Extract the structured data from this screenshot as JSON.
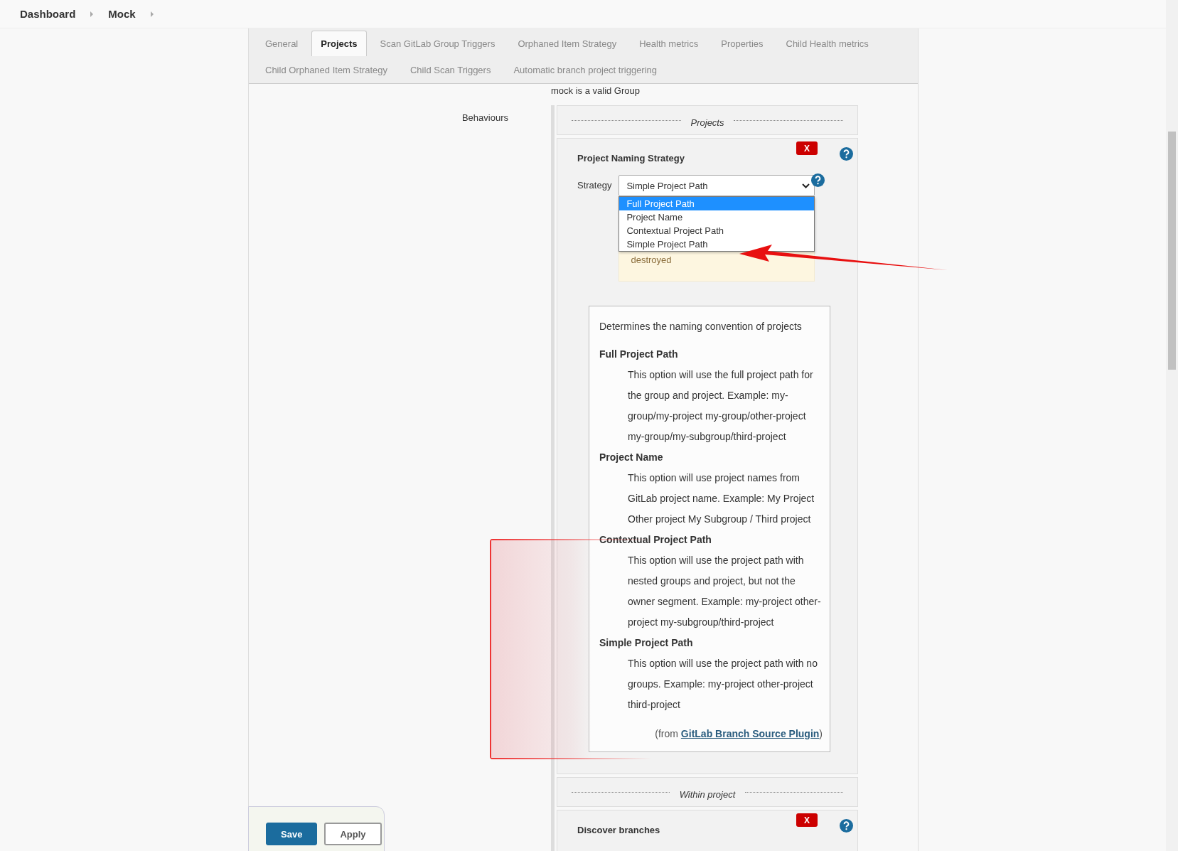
{
  "breadcrumb": [
    {
      "label": "Dashboard"
    },
    {
      "label": "Mock"
    }
  ],
  "tabs": [
    {
      "label": "General",
      "selected": false
    },
    {
      "label": "Projects",
      "selected": true
    },
    {
      "label": "Scan GitLab Group Triggers",
      "selected": false
    },
    {
      "label": "Orphaned Item Strategy",
      "selected": false
    },
    {
      "label": "Health metrics",
      "selected": false
    },
    {
      "label": "Properties",
      "selected": false
    },
    {
      "label": "Child Health metrics",
      "selected": false
    },
    {
      "label": "Child Orphaned Item Strategy",
      "selected": false
    },
    {
      "label": "Child Scan Triggers",
      "selected": false
    },
    {
      "label": "Automatic branch project triggering",
      "selected": false
    }
  ],
  "validation_message": "mock is a valid Group",
  "behaviours_label": "Behaviours",
  "sections": [
    {
      "kind": "header",
      "title": "Projects"
    },
    {
      "kind": "trait",
      "title": "Project Naming Strategy",
      "delete_label": "X",
      "strategy": {
        "label": "Strategy",
        "value": "Simple Project Path",
        "expanded": true,
        "options": [
          {
            "label": "Full Project Path",
            "highlighted": true
          },
          {
            "label": "Project Name",
            "highlighted": false
          },
          {
            "label": "Contextual Project Path",
            "highlighted": false
          },
          {
            "label": "Simple Project Path",
            "highlighted": false
          }
        ],
        "warning": "destroyed"
      },
      "help": {
        "intro": "Determines the naming convention of projects",
        "entries": [
          {
            "term": "Full Project Path",
            "description": "This option will use the full project path for the group and project. Example: my-group/my-project my-group/other-project my-group/my-subgroup/third-project"
          },
          {
            "term": "Project Name",
            "description": "This option will use project names from GitLab project name. Example: My Project Other project My Subgroup / Third project"
          },
          {
            "term": "Contextual Project Path",
            "description": "This option will use the project path with nested groups and project, but not the owner segment. Example: my-project other-project my-subgroup/third-project"
          },
          {
            "term": "Simple Project Path",
            "description": "This option will use the project path with no groups. Example: my-project other-project third-project"
          }
        ],
        "source_prefix": "(from ",
        "source_link": "GitLab Branch Source Plugin",
        "source_suffix": ")"
      }
    },
    {
      "kind": "header",
      "title": "Within project"
    },
    {
      "kind": "trait",
      "title": "Discover branches",
      "delete_label": "X"
    }
  ],
  "buttons": [
    {
      "label": "Save",
      "kind": "primary"
    },
    {
      "label": "Apply",
      "kind": "secondary"
    }
  ]
}
